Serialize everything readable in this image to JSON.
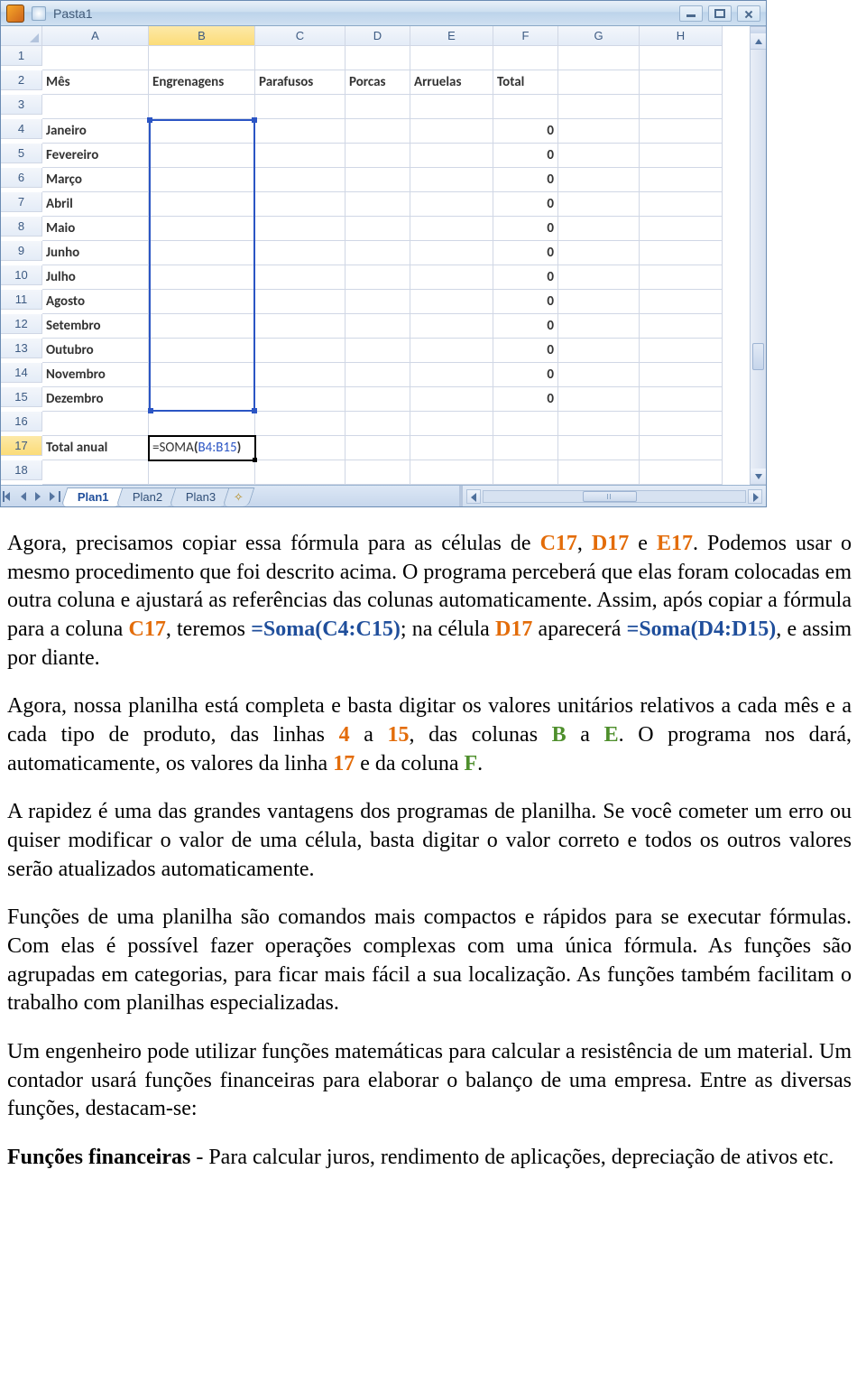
{
  "excel": {
    "window_title": "Pasta1",
    "columns": [
      "A",
      "B",
      "C",
      "D",
      "E",
      "F",
      "G",
      "H"
    ],
    "row_numbers": [
      1,
      2,
      3,
      4,
      5,
      6,
      7,
      8,
      9,
      10,
      11,
      12,
      13,
      14,
      15,
      16,
      17,
      18
    ],
    "headers": {
      "A": "Mês",
      "B": "Engrenagens",
      "C": "Parafusos",
      "D": "Porcas",
      "E": "Arruelas",
      "F": "Total"
    },
    "months": [
      "Janeiro",
      "Fevereiro",
      "Março",
      "Abril",
      "Maio",
      "Junho",
      "Julho",
      "Agosto",
      "Setembro",
      "Outubro",
      "Novembro",
      "Dezembro"
    ],
    "total_label": "Total anual",
    "total_value": "0",
    "formula": {
      "prefix": "=SOMA",
      "open": "(",
      "range": "B4:B15",
      "close": ")"
    },
    "tabs": [
      "Plan1",
      "Plan2",
      "Plan3"
    ]
  },
  "doc": {
    "p1": {
      "t1": "Agora, precisamos copiar essa fórmula para as células de ",
      "c17": "C17",
      "sep1": ", ",
      "d17": "D17",
      "sep2": " e ",
      "e17": "E17",
      "t2": ". Podemos usar o mesmo procedimento que foi descrito acima. O programa perceberá que elas foram colocadas em outra coluna e ajustará as referências das colunas automaticamente. Assim, após copiar a fórmula para a coluna ",
      "c17b": "C17",
      "t3": ", teremos ",
      "f1": "=Soma(C4:C15)",
      "t4": "; na célula ",
      "d17b": "D17",
      "t5": " aparecerá ",
      "f2": "=Soma(D4:D15)",
      "t6": ", e assim por diante."
    },
    "p2": {
      "t1": "Agora, nossa planilha está completa e basta digitar os valores unitários relativos a cada mês e a cada tipo de produto, das linhas ",
      "n4": "4",
      "t2": " a ",
      "n15": "15",
      "t3": ", das colunas ",
      "cB": "B",
      "t4": " a ",
      "cE": "E",
      "t5": ". O programa nos dará, automaticamente, os valores da linha ",
      "n17": "17",
      "t6": " e da coluna ",
      "cF": "F",
      "t7": "."
    },
    "p3": "A rapidez é uma das grandes vantagens dos programas de planilha. Se você cometer um erro ou quiser modificar o valor de uma célula, basta digitar o valor correto e todos os outros valores serão atualizados automaticamente.",
    "p4": "Funções de uma planilha são comandos mais compactos e rápidos para se executar fórmulas. Com elas é possível fazer operações complexas com uma única fórmula. As funções são agrupadas em categorias, para ficar mais fácil a sua localização. As funções também facilitam o trabalho com planilhas especializadas.",
    "p5": "Um engenheiro pode utilizar funções matemáticas para calcular a resistência de um material. Um contador usará funções financeiras para elaborar o balanço de uma empresa. Entre as diversas funções, destacam-se:",
    "p6": {
      "b": "Funções financeiras",
      "t": " - Para calcular juros, rendimento de aplicações, depreciação de ativos etc."
    }
  }
}
